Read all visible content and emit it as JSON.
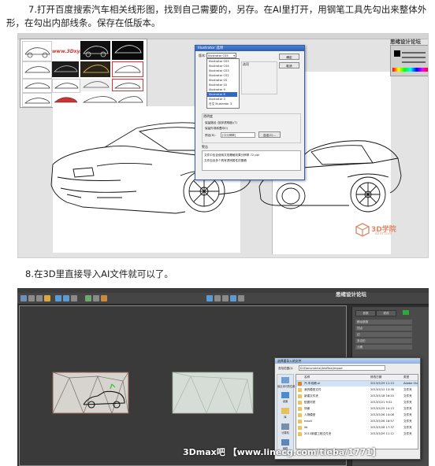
{
  "step7": {
    "text": "7.打开百度搜索汽车相关线形图，找到自己需要的，另存。在AI里打开，用钢笔工具先勾出来整体外形，在勾出内部线条。保存在低版本。"
  },
  "step8": {
    "text": "8.在3D里直接导入AI文件就可以了。"
  },
  "ai_screenshot": {
    "gallery_watermark": "www.3Dxy.com",
    "dialog": {
      "title": "Illustrator 选项",
      "version_label": "版本:",
      "version_value": "Illustrator CS5",
      "version_options": [
        "Illustrator CS5",
        "Illustrator CS4",
        "Illustrator CS3",
        "Illustrator CS2",
        "Illustrator CS",
        "Illustrator 10",
        "Illustrator 9",
        "Illustrator 8",
        "Illustrator 3",
        "日文 Illustrator 3"
      ],
      "selected_option": "Illustrator 8",
      "ok_label": "确定",
      "cancel_label": "取消",
      "options_section": "选项",
      "warnings_section": "警告",
      "warning_1": "文件中包含使用文档栅格效果分辨率 72 ppi",
      "warning_2": "文件包含多个具有透明属性的图稿",
      "transparency_label": "透明度",
      "preserve_paths": "保留路径 (放弃透明度)(T)",
      "preserve_appearance": "保留外观和叠印(I)",
      "preset_label": "预设(R):",
      "preset_value": "[中分辨率]",
      "custom_button": "自定(C)..."
    },
    "brand_watermark": "3D学院",
    "brand_watermark_url": "3DXY.com",
    "corner_logo": "思绪设计论坛"
  },
  "max_screenshot": {
    "corner_logo": "思绪设计论坛",
    "watermark": "3Dmax吧 【www.linecg.com/tieba/1771】",
    "dialog": {
      "title": "选择要导入的文件",
      "search_in": "查找范围(I):",
      "folder": "D:\\Documents\\3dsMax\\import",
      "places": [
        "最近访问的位置",
        "桌面",
        "库",
        "计算机",
        "网络"
      ],
      "columns": [
        "名称",
        "修改日期",
        "类型"
      ],
      "files": [
        {
          "name": "汽-车线稿.ai",
          "date": "2013/5/29 11:13",
          "type": "Adobe Illust"
        },
        {
          "name": "我的模型文件",
          "date": "2013/5/12 13:38",
          "type": "文件夹"
        },
        {
          "name": "新建文件夹",
          "date": "2013/5/18 16:20",
          "type": "文件夹"
        },
        {
          "name": "贴图材质",
          "date": "2013/5/21 9:52",
          "type": "文件夹"
        },
        {
          "name": "场景",
          "date": "2013/5/25 10:13",
          "type": "文件夹"
        },
        {
          "name": "人物模型",
          "date": "2013/5/26 14:08",
          "type": "文件夹"
        },
        {
          "name": "maxV",
          "date": "2013/5/26 18:57",
          "type": "文件夹"
        },
        {
          "name": "lib",
          "date": "2013/5/28 17:37",
          "type": "文件夹"
        },
        {
          "name": "2013新建工程文件夹",
          "date": "2013/5/29 11:12",
          "type": "文件夹"
        }
      ]
    },
    "panel": {
      "tabs": [
        "参数",
        "修改"
      ],
      "rows": [
        "移动参数",
        "顶点",
        "边",
        "多边形",
        "元素"
      ]
    }
  }
}
